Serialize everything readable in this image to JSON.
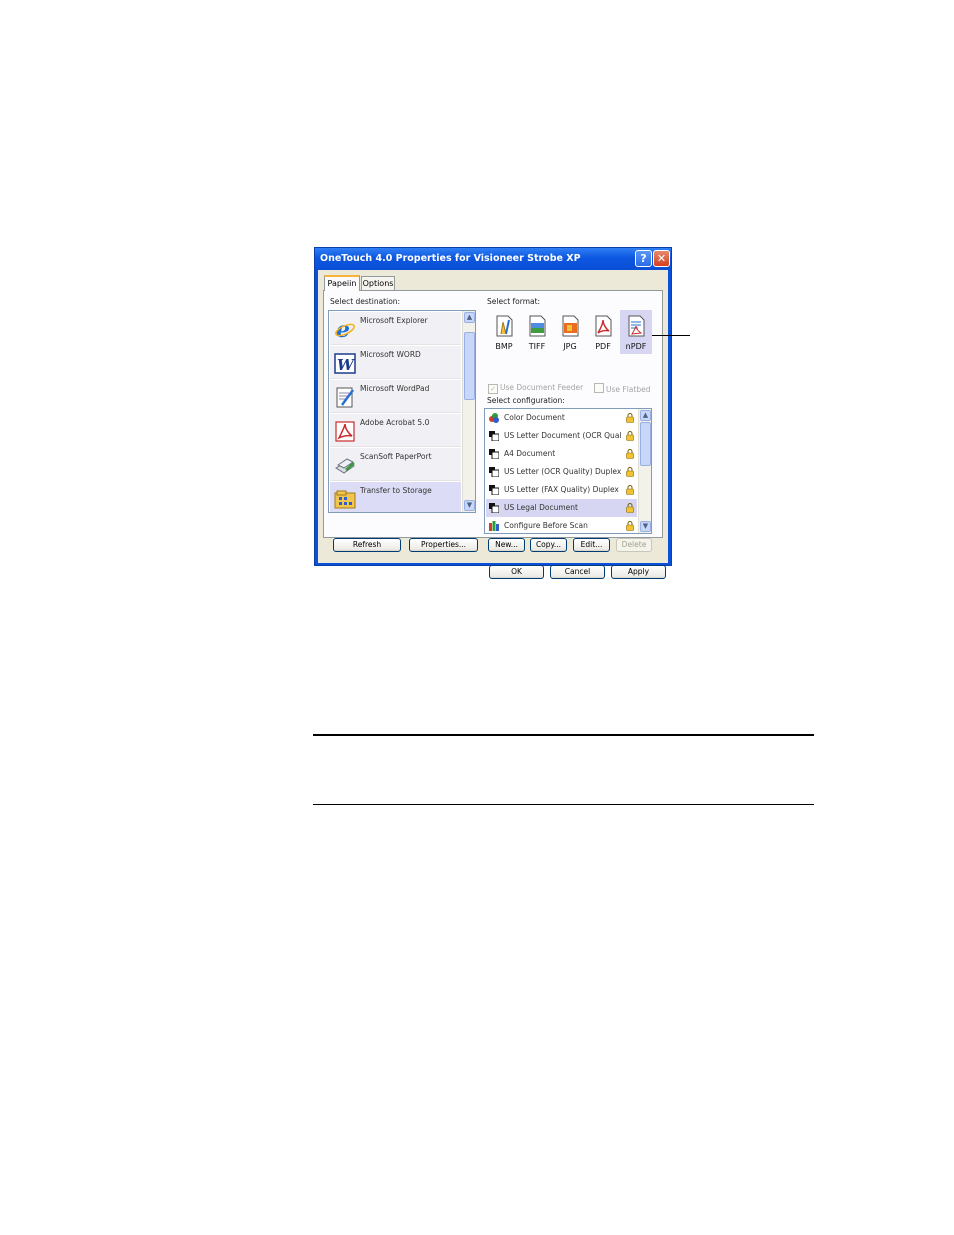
{
  "window": {
    "title": "OneTouch 4.0 Properties for Visioneer Strobe XP"
  },
  "tabs": [
    {
      "label": "Papeiin"
    },
    {
      "label": "Options"
    }
  ],
  "destination": {
    "label": "Select destination:",
    "items": [
      {
        "label": "Microsoft Explorer",
        "icon": "internet-explorer-icon"
      },
      {
        "label": "Microsoft WORD",
        "icon": "word-icon"
      },
      {
        "label": "Microsoft WordPad",
        "icon": "wordpad-icon"
      },
      {
        "label": "Adobe Acrobat 5.0",
        "icon": "acrobat-icon"
      },
      {
        "label": "ScanSoft PaperPort",
        "icon": "paperport-icon"
      },
      {
        "label": "Transfer to Storage",
        "icon": "storage-icon",
        "selected": true
      }
    ],
    "refresh_label": "Refresh",
    "properties_label": "Properties..."
  },
  "format": {
    "label": "Select format:",
    "options": [
      {
        "label": "BMP"
      },
      {
        "label": "TIFF"
      },
      {
        "label": "JPG"
      },
      {
        "label": "PDF"
      },
      {
        "label": "nPDF",
        "selected": true
      }
    ],
    "use_feeder_label": "Use Document Feeder",
    "use_flatbed_label": "Use Flatbed"
  },
  "configuration": {
    "label": "Select configuration:",
    "items": [
      {
        "label": "Color Document"
      },
      {
        "label": "US Letter Document (OCR Quality)"
      },
      {
        "label": "A4 Document"
      },
      {
        "label": "US Letter (OCR Quality) Duplex"
      },
      {
        "label": "US Letter (FAX Quality) Duplex"
      },
      {
        "label": "US Legal Document",
        "selected": true
      },
      {
        "label": "Configure Before Scan"
      }
    ],
    "new_label": "New...",
    "copy_label": "Copy...",
    "edit_label": "Edit...",
    "delete_label": "Delete"
  },
  "footer": {
    "ok_label": "OK",
    "cancel_label": "Cancel",
    "apply_label": "Apply"
  },
  "colors": {
    "titlebar": "#0a50d8",
    "selection": "#d6d6f2",
    "dialog_face": "#ece9d8"
  }
}
